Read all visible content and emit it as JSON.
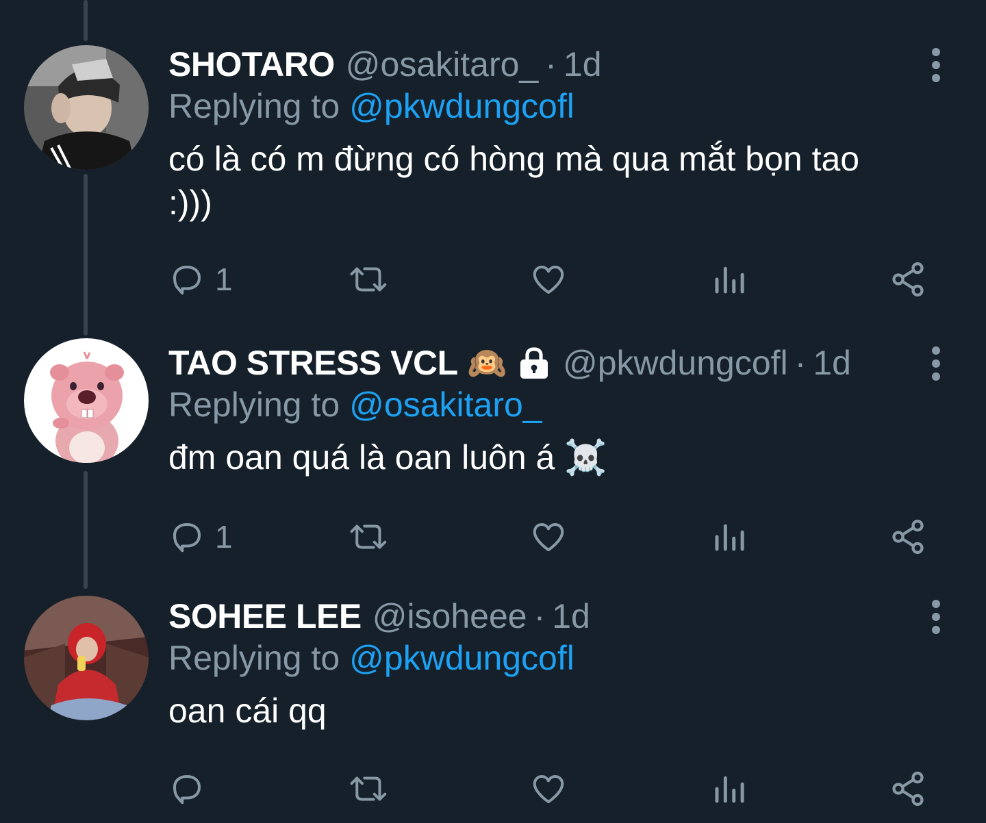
{
  "tweets": [
    {
      "name": "SHOTARO",
      "handle": "@osakitaro_",
      "dot": "·",
      "time": "1d",
      "replying_prefix": "Replying to",
      "replying_to": "@pkwdungcofl",
      "text": "có là có m đừng có hòng mà qua mắt bọn tao :)))",
      "reply_count": "1"
    },
    {
      "name": "TAO STRESS VCL",
      "emoji": "🙉",
      "handle": "@pkwdungcofl",
      "dot": "·",
      "time": "1d",
      "replying_prefix": "Replying to",
      "replying_to": "@osakitaro_",
      "text": "đm oan quá là oan luôn á ☠️",
      "reply_count": "1"
    },
    {
      "name": "SOHEE LEE",
      "handle": "@isoheee",
      "dot": "·",
      "time": "1d",
      "replying_prefix": "Replying to",
      "replying_to": "@pkwdungcofl",
      "text": "oan cái qq",
      "reply_count": ""
    }
  ],
  "icons": {
    "reply": "reply-icon",
    "retweet": "retweet-icon",
    "like": "heart-icon",
    "analytics": "analytics-icon",
    "share": "share-icon",
    "more": "more-vertical-icon",
    "protected": "lock-icon"
  },
  "colors": {
    "background": "#15202b",
    "text": "#ffffff",
    "secondary": "#8899a6",
    "link": "#1da1f2",
    "thread_line": "#38444d"
  }
}
